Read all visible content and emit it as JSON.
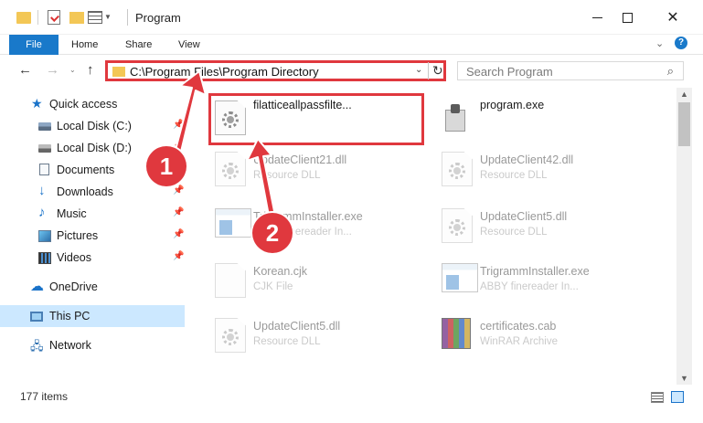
{
  "window": {
    "title": "Program",
    "min_icon": "minimize-icon",
    "max_icon": "maximize-icon",
    "close_glyph": "✕"
  },
  "ribbon": {
    "tabs": [
      "File",
      "Home",
      "Share",
      "View"
    ],
    "help_glyph": "?"
  },
  "nav": {
    "address": "C:\\Program Files\\Program Directory",
    "search_placeholder": "Search Program"
  },
  "sidebar": {
    "items": [
      {
        "label": "Quick access",
        "icon": "star-icon"
      },
      {
        "label": "Local Disk (C:)",
        "icon": "disk-icon",
        "pinned": true
      },
      {
        "label": "Local Disk (D:)",
        "icon": "disk-icon",
        "pinned": true
      },
      {
        "label": "Documents",
        "icon": "documents-icon",
        "pinned": true
      },
      {
        "label": "Downloads",
        "icon": "downloads-icon",
        "pinned": true
      },
      {
        "label": "Music",
        "icon": "music-icon",
        "pinned": true
      },
      {
        "label": "Pictures",
        "icon": "pictures-icon",
        "pinned": true
      },
      {
        "label": "Videos",
        "icon": "videos-icon",
        "pinned": true
      },
      {
        "label": "OneDrive",
        "icon": "onedrive-icon"
      },
      {
        "label": "This PC",
        "icon": "this-pc-icon",
        "selected": true
      },
      {
        "label": "Network",
        "icon": "network-icon"
      }
    ]
  },
  "files": [
    {
      "name": "filatticeallpassfilte...",
      "type": "",
      "icon": "dll-icon",
      "highlighted": true
    },
    {
      "name": "program.exe",
      "type": "",
      "icon": "program-icon"
    },
    {
      "name": "UpdateClient21.dll",
      "type": "Resource DLL",
      "icon": "dll-icon"
    },
    {
      "name": "UpdateClient42.dll",
      "type": "Resource DLL",
      "icon": "dll-icon"
    },
    {
      "name": "TrigrammInstaller.exe",
      "type": "ABBY finereader In...",
      "icon": "exe-icon"
    },
    {
      "name": "UpdateClient5.dll",
      "type": "Resource DLL",
      "icon": "dll-icon"
    },
    {
      "name": "Korean.cjk",
      "type": "CJK File",
      "icon": "file-icon"
    },
    {
      "name": "TrigrammInstaller.exe",
      "type": "ABBY finereader In...",
      "icon": "exe-icon"
    },
    {
      "name": "UpdateClient5.dll",
      "type": "Resource DLL",
      "icon": "dll-icon"
    },
    {
      "name": "certificates.cab",
      "type": "WinRAR Archive",
      "icon": "cab-icon"
    }
  ],
  "status": {
    "item_count": "177 items"
  },
  "annotations": {
    "step1": "1",
    "step2": "2",
    "accent_color": "#e0383e"
  }
}
